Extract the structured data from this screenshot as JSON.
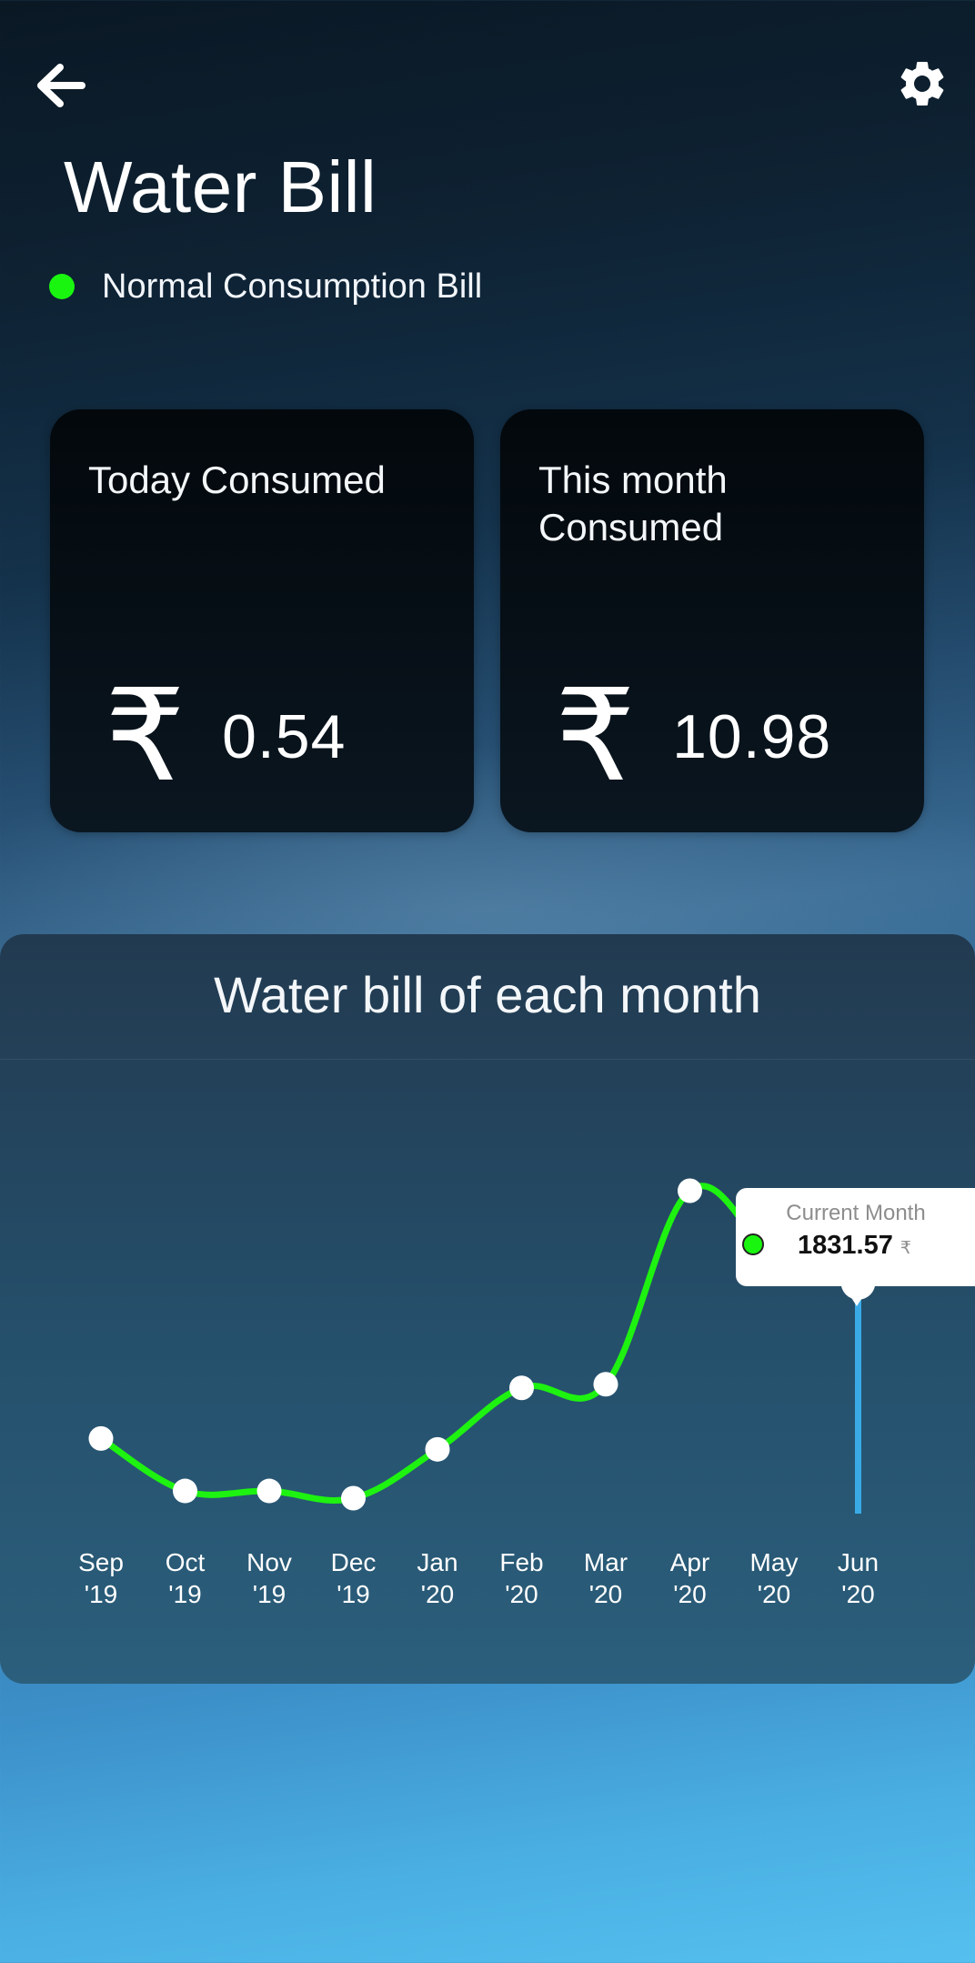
{
  "header": {
    "back_icon": "arrow-left-icon",
    "settings_icon": "gear-icon"
  },
  "page": {
    "title": "Water Bill",
    "status_label": "Normal Consumption Bill",
    "status_color": "#19f50f"
  },
  "cards": {
    "today": {
      "title": "Today Consumed",
      "currency": "₹",
      "value": "0.54"
    },
    "month": {
      "title": "This month Consumed",
      "currency": "₹",
      "value": "10.98"
    }
  },
  "chart_section": {
    "title": "Water bill of each month"
  },
  "tooltip": {
    "label": "Current Month",
    "value": "1831.57",
    "unit": "₹"
  },
  "chart_data": {
    "type": "line",
    "title": "Water bill of each month",
    "categories": [
      "Sep '19",
      "Oct '19",
      "Nov '19",
      "Dec '19",
      "Jan '20",
      "Feb '20",
      "Mar '20",
      "Apr '20",
      "May '20",
      "Jun '20"
    ],
    "category_lines": [
      [
        "Sep",
        "'19"
      ],
      [
        "Oct",
        "'19"
      ],
      [
        "Nov",
        "'19"
      ],
      [
        "Dec",
        "'19"
      ],
      [
        "Jan",
        "'20"
      ],
      [
        "Feb",
        "'20"
      ],
      [
        "Mar",
        "'20"
      ],
      [
        "Apr",
        "'20"
      ],
      [
        "May",
        "'20"
      ],
      [
        "Jun",
        "'20"
      ]
    ],
    "values": [
      1400,
      1255,
      1255,
      1235,
      1370,
      1540,
      1550,
      2085,
      1910,
      1831.57
    ],
    "highlight_index": 9,
    "line_color": "#1ef210",
    "highlight_color": "#3aaae6",
    "point_color": "#ffffff",
    "grid": false,
    "legend": "none"
  }
}
